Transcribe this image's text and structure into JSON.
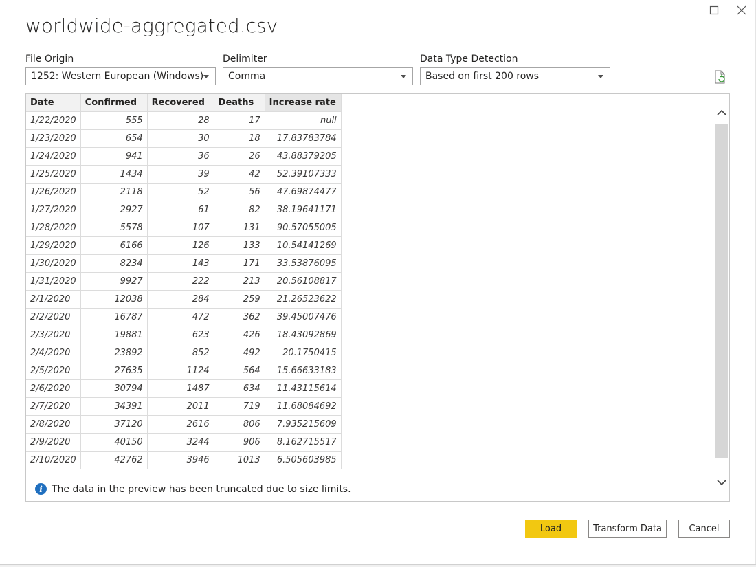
{
  "window": {
    "title": "worldwide-aggregated.csv"
  },
  "options": {
    "file_origin": {
      "label": "File Origin",
      "value": "1252: Western European (Windows)"
    },
    "delimiter": {
      "label": "Delimiter",
      "value": "Comma"
    },
    "data_type_detection": {
      "label": "Data Type Detection",
      "value": "Based on first 200 rows"
    }
  },
  "table": {
    "columns": [
      "Date",
      "Confirmed",
      "Recovered",
      "Deaths",
      "Increase rate"
    ],
    "rows": [
      [
        "1/22/2020",
        "555",
        "28",
        "17",
        "null"
      ],
      [
        "1/23/2020",
        "654",
        "30",
        "18",
        "17.83783784"
      ],
      [
        "1/24/2020",
        "941",
        "36",
        "26",
        "43.88379205"
      ],
      [
        "1/25/2020",
        "1434",
        "39",
        "42",
        "52.39107333"
      ],
      [
        "1/26/2020",
        "2118",
        "52",
        "56",
        "47.69874477"
      ],
      [
        "1/27/2020",
        "2927",
        "61",
        "82",
        "38.19641171"
      ],
      [
        "1/28/2020",
        "5578",
        "107",
        "131",
        "90.57055005"
      ],
      [
        "1/29/2020",
        "6166",
        "126",
        "133",
        "10.54141269"
      ],
      [
        "1/30/2020",
        "8234",
        "143",
        "171",
        "33.53876095"
      ],
      [
        "1/31/2020",
        "9927",
        "222",
        "213",
        "20.56108817"
      ],
      [
        "2/1/2020",
        "12038",
        "284",
        "259",
        "21.26523622"
      ],
      [
        "2/2/2020",
        "16787",
        "472",
        "362",
        "39.45007476"
      ],
      [
        "2/3/2020",
        "19881",
        "623",
        "426",
        "18.43092869"
      ],
      [
        "2/4/2020",
        "23892",
        "852",
        "492",
        "20.1750415"
      ],
      [
        "2/5/2020",
        "27635",
        "1124",
        "564",
        "15.66633183"
      ],
      [
        "2/6/2020",
        "30794",
        "1487",
        "634",
        "11.43115614"
      ],
      [
        "2/7/2020",
        "34391",
        "2011",
        "719",
        "11.68084692"
      ],
      [
        "2/8/2020",
        "37120",
        "2616",
        "806",
        "7.935215609"
      ],
      [
        "2/9/2020",
        "40150",
        "3244",
        "906",
        "8.162715517"
      ],
      [
        "2/10/2020",
        "42762",
        "3946",
        "1013",
        "6.505603985"
      ]
    ]
  },
  "info_message": "The data in the preview has been truncated due to size limits.",
  "buttons": {
    "load": "Load",
    "transform": "Transform Data",
    "cancel": "Cancel"
  },
  "icons": {
    "maximize": "maximize-icon",
    "close": "close-icon",
    "refresh": "refresh-file-icon",
    "info": "info-icon",
    "scroll_up": "chevron-up-icon",
    "scroll_down": "chevron-down-icon"
  },
  "colors": {
    "accent_load": "#f2c811",
    "info_icon": "#1f6fbf"
  }
}
